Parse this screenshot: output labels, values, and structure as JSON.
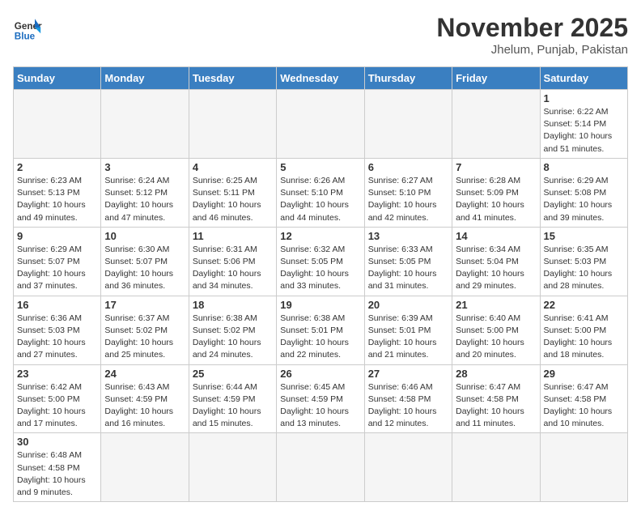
{
  "header": {
    "logo_general": "General",
    "logo_blue": "Blue",
    "month_year": "November 2025",
    "location": "Jhelum, Punjab, Pakistan"
  },
  "weekdays": [
    "Sunday",
    "Monday",
    "Tuesday",
    "Wednesday",
    "Thursday",
    "Friday",
    "Saturday"
  ],
  "weeks": [
    [
      {
        "day": "",
        "info": ""
      },
      {
        "day": "",
        "info": ""
      },
      {
        "day": "",
        "info": ""
      },
      {
        "day": "",
        "info": ""
      },
      {
        "day": "",
        "info": ""
      },
      {
        "day": "",
        "info": ""
      },
      {
        "day": "1",
        "info": "Sunrise: 6:22 AM\nSunset: 5:14 PM\nDaylight: 10 hours and 51 minutes."
      }
    ],
    [
      {
        "day": "2",
        "info": "Sunrise: 6:23 AM\nSunset: 5:13 PM\nDaylight: 10 hours and 49 minutes."
      },
      {
        "day": "3",
        "info": "Sunrise: 6:24 AM\nSunset: 5:12 PM\nDaylight: 10 hours and 47 minutes."
      },
      {
        "day": "4",
        "info": "Sunrise: 6:25 AM\nSunset: 5:11 PM\nDaylight: 10 hours and 46 minutes."
      },
      {
        "day": "5",
        "info": "Sunrise: 6:26 AM\nSunset: 5:10 PM\nDaylight: 10 hours and 44 minutes."
      },
      {
        "day": "6",
        "info": "Sunrise: 6:27 AM\nSunset: 5:10 PM\nDaylight: 10 hours and 42 minutes."
      },
      {
        "day": "7",
        "info": "Sunrise: 6:28 AM\nSunset: 5:09 PM\nDaylight: 10 hours and 41 minutes."
      },
      {
        "day": "8",
        "info": "Sunrise: 6:29 AM\nSunset: 5:08 PM\nDaylight: 10 hours and 39 minutes."
      }
    ],
    [
      {
        "day": "9",
        "info": "Sunrise: 6:29 AM\nSunset: 5:07 PM\nDaylight: 10 hours and 37 minutes."
      },
      {
        "day": "10",
        "info": "Sunrise: 6:30 AM\nSunset: 5:07 PM\nDaylight: 10 hours and 36 minutes."
      },
      {
        "day": "11",
        "info": "Sunrise: 6:31 AM\nSunset: 5:06 PM\nDaylight: 10 hours and 34 minutes."
      },
      {
        "day": "12",
        "info": "Sunrise: 6:32 AM\nSunset: 5:05 PM\nDaylight: 10 hours and 33 minutes."
      },
      {
        "day": "13",
        "info": "Sunrise: 6:33 AM\nSunset: 5:05 PM\nDaylight: 10 hours and 31 minutes."
      },
      {
        "day": "14",
        "info": "Sunrise: 6:34 AM\nSunset: 5:04 PM\nDaylight: 10 hours and 29 minutes."
      },
      {
        "day": "15",
        "info": "Sunrise: 6:35 AM\nSunset: 5:03 PM\nDaylight: 10 hours and 28 minutes."
      }
    ],
    [
      {
        "day": "16",
        "info": "Sunrise: 6:36 AM\nSunset: 5:03 PM\nDaylight: 10 hours and 27 minutes."
      },
      {
        "day": "17",
        "info": "Sunrise: 6:37 AM\nSunset: 5:02 PM\nDaylight: 10 hours and 25 minutes."
      },
      {
        "day": "18",
        "info": "Sunrise: 6:38 AM\nSunset: 5:02 PM\nDaylight: 10 hours and 24 minutes."
      },
      {
        "day": "19",
        "info": "Sunrise: 6:38 AM\nSunset: 5:01 PM\nDaylight: 10 hours and 22 minutes."
      },
      {
        "day": "20",
        "info": "Sunrise: 6:39 AM\nSunset: 5:01 PM\nDaylight: 10 hours and 21 minutes."
      },
      {
        "day": "21",
        "info": "Sunrise: 6:40 AM\nSunset: 5:00 PM\nDaylight: 10 hours and 20 minutes."
      },
      {
        "day": "22",
        "info": "Sunrise: 6:41 AM\nSunset: 5:00 PM\nDaylight: 10 hours and 18 minutes."
      }
    ],
    [
      {
        "day": "23",
        "info": "Sunrise: 6:42 AM\nSunset: 5:00 PM\nDaylight: 10 hours and 17 minutes."
      },
      {
        "day": "24",
        "info": "Sunrise: 6:43 AM\nSunset: 4:59 PM\nDaylight: 10 hours and 16 minutes."
      },
      {
        "day": "25",
        "info": "Sunrise: 6:44 AM\nSunset: 4:59 PM\nDaylight: 10 hours and 15 minutes."
      },
      {
        "day": "26",
        "info": "Sunrise: 6:45 AM\nSunset: 4:59 PM\nDaylight: 10 hours and 13 minutes."
      },
      {
        "day": "27",
        "info": "Sunrise: 6:46 AM\nSunset: 4:58 PM\nDaylight: 10 hours and 12 minutes."
      },
      {
        "day": "28",
        "info": "Sunrise: 6:47 AM\nSunset: 4:58 PM\nDaylight: 10 hours and 11 minutes."
      },
      {
        "day": "29",
        "info": "Sunrise: 6:47 AM\nSunset: 4:58 PM\nDaylight: 10 hours and 10 minutes."
      }
    ],
    [
      {
        "day": "30",
        "info": "Sunrise: 6:48 AM\nSunset: 4:58 PM\nDaylight: 10 hours and 9 minutes."
      },
      {
        "day": "",
        "info": ""
      },
      {
        "day": "",
        "info": ""
      },
      {
        "day": "",
        "info": ""
      },
      {
        "day": "",
        "info": ""
      },
      {
        "day": "",
        "info": ""
      },
      {
        "day": "",
        "info": ""
      }
    ]
  ]
}
